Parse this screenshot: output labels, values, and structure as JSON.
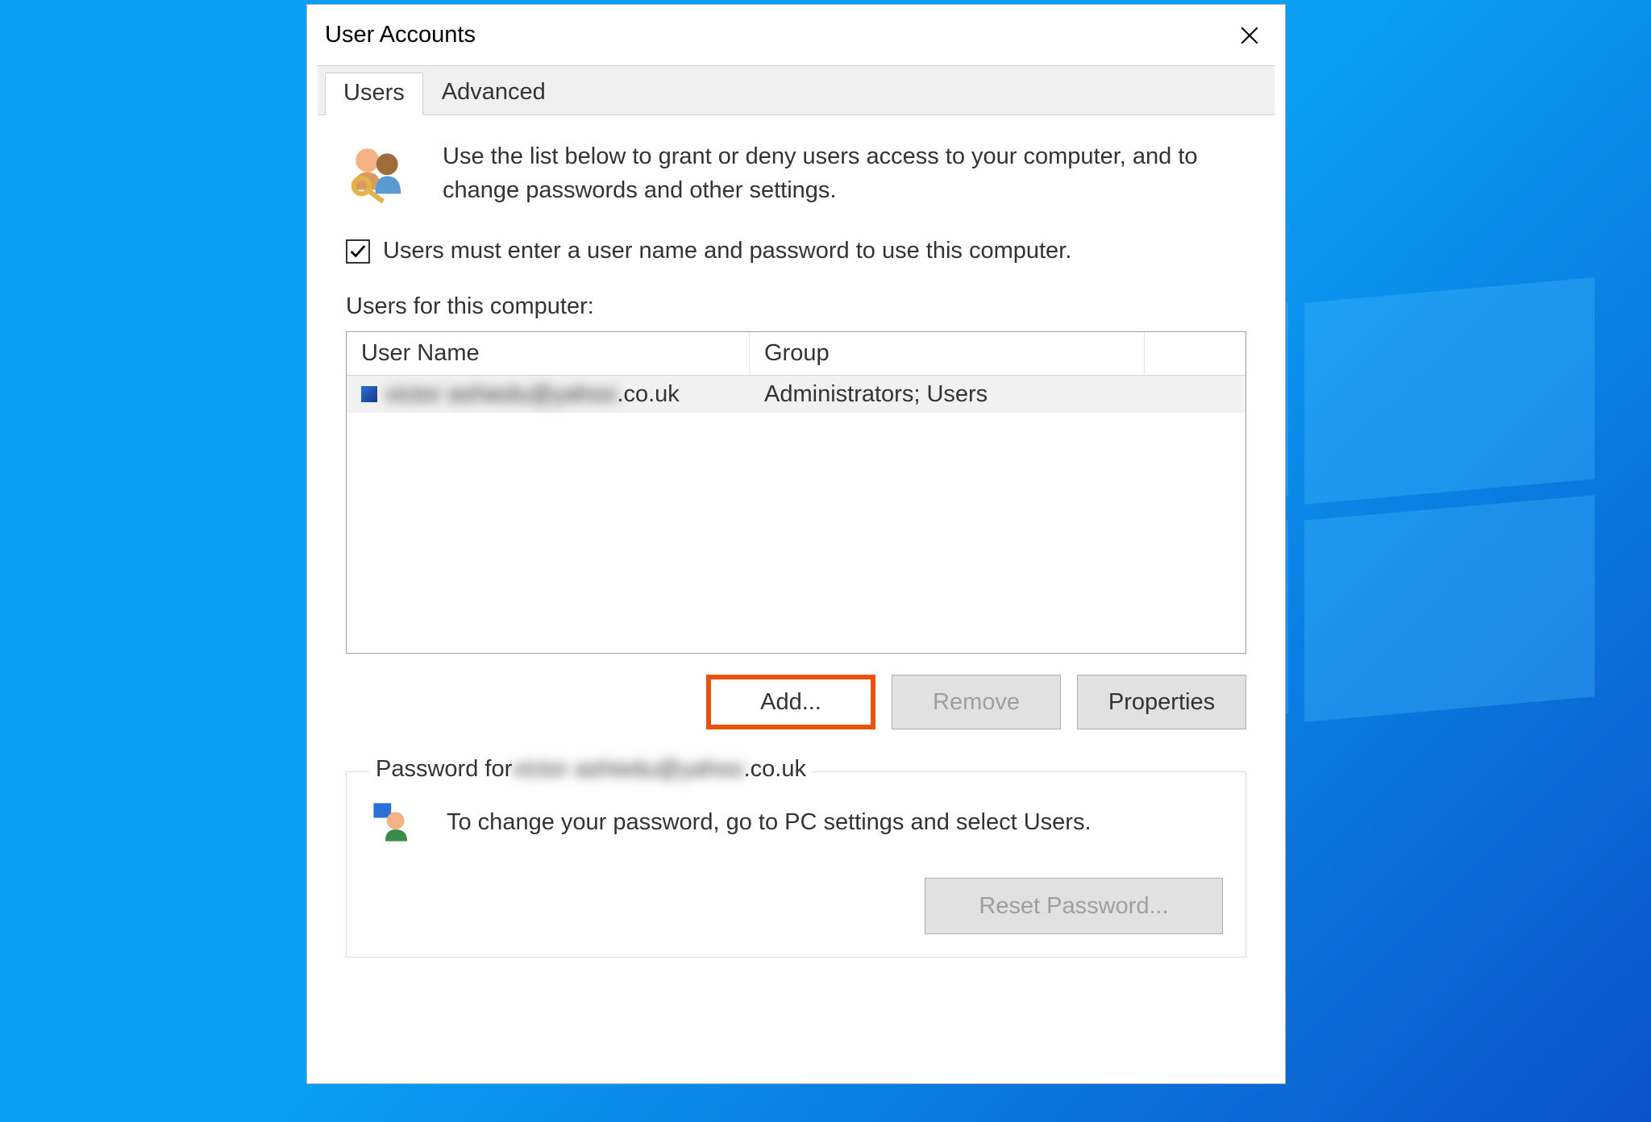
{
  "window": {
    "title": "User Accounts"
  },
  "tabs": [
    {
      "label": "Users",
      "active": true
    },
    {
      "label": "Advanced",
      "active": false
    }
  ],
  "intro_text": "Use the list below to grant or deny users access to your computer, and to change passwords and other settings.",
  "must_enter_checkbox": {
    "checked": true,
    "label": "Users must enter a user name and password to use this computer."
  },
  "users_section": {
    "heading": "Users for this computer:",
    "columns": [
      "User Name",
      "Group"
    ],
    "rows": [
      {
        "username_visible_suffix": ".co.uk",
        "username_obscured": "victor ashiedu@yahoo",
        "group": "Administrators; Users"
      }
    ]
  },
  "buttons": {
    "add": "Add...",
    "remove": "Remove",
    "properties": "Properties"
  },
  "password_group": {
    "legend_prefix": "Password for ",
    "legend_obscured": "victor ashiedu@yahoo",
    "legend_suffix": ".co.uk",
    "body": "To change your password, go to PC settings and select Users.",
    "reset_button": "Reset Password..."
  }
}
